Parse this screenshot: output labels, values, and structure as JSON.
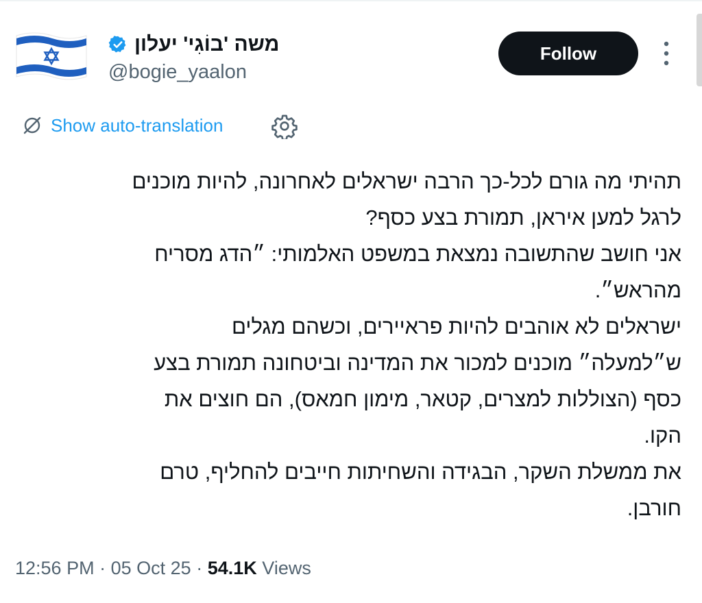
{
  "author": {
    "display_name": "משה 'בוֹגִי' יעלון",
    "handle": "@bogie_yaalon",
    "avatar_icon": "israel-flag-icon",
    "verified_icon": "verified-badge-icon"
  },
  "actions": {
    "follow_label": "Follow",
    "more_icon": "more-vertical-icon"
  },
  "translation": {
    "link_label": "Show auto-translation",
    "icon": "translate-icon",
    "settings_icon": "gear-icon"
  },
  "tweet": {
    "lines": [
      "תהיתי מה גורם לכל-כך הרבה ישראלים לאחרונה, להיות מוכנים",
      "לרגל למען איראן, תמורת בצע כסף?",
      "אני חושב שהתשובה נמצאת במשפט האלמותי: ״הדג מסריח",
      "מהראש״.",
      "ישראלים לא אוהבים להיות פראיירים, וכשהם מגלים",
      "ש״למעלה״ מוכנים למכור את המדינה וביטחונה תמורת בצע",
      "כסף (הצוללות למצרים, קטאר, מימון חמאס), הם חוצים את",
      "הקו.",
      "את ממשלת השקר, הבגידה והשחיתות חייבים להחליף, טרם",
      "חורבן."
    ]
  },
  "meta": {
    "time": "12:56 PM",
    "separator": "·",
    "date": "05 Oct 25",
    "views_count": "54.1K",
    "views_label": "Views"
  },
  "colors": {
    "accent": "#1d9bf0",
    "text_primary": "#0f1419",
    "text_secondary": "#536471",
    "button_bg": "#0f1419"
  }
}
